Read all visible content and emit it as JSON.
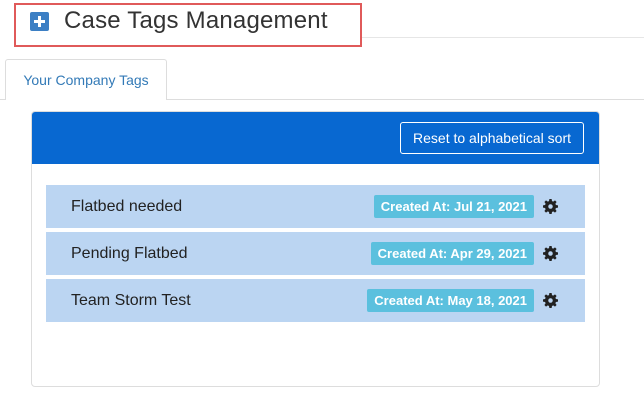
{
  "header": {
    "title": "Case Tags Management",
    "icon": "plus-square-icon",
    "accent_color": "#3c7fc4",
    "highlight_color": "#e05a5a"
  },
  "tabs": [
    {
      "label": "Your Company Tags",
      "active": true
    }
  ],
  "panel": {
    "heading_color": "#0868d1",
    "reset_button_label": "Reset to alphabetical sort",
    "tags": [
      {
        "name": "Flatbed needed",
        "created": "Created At: Jul 21, 2021",
        "settings_icon": "gear-icon"
      },
      {
        "name": "Pending Flatbed",
        "created": "Created At: Apr 29, 2021",
        "settings_icon": "gear-icon"
      },
      {
        "name": "Team Storm Test",
        "created": "Created At: May 18, 2021",
        "settings_icon": "gear-icon"
      }
    ],
    "row_color": "#bbd5f2",
    "badge_color": "#5bc0de"
  }
}
